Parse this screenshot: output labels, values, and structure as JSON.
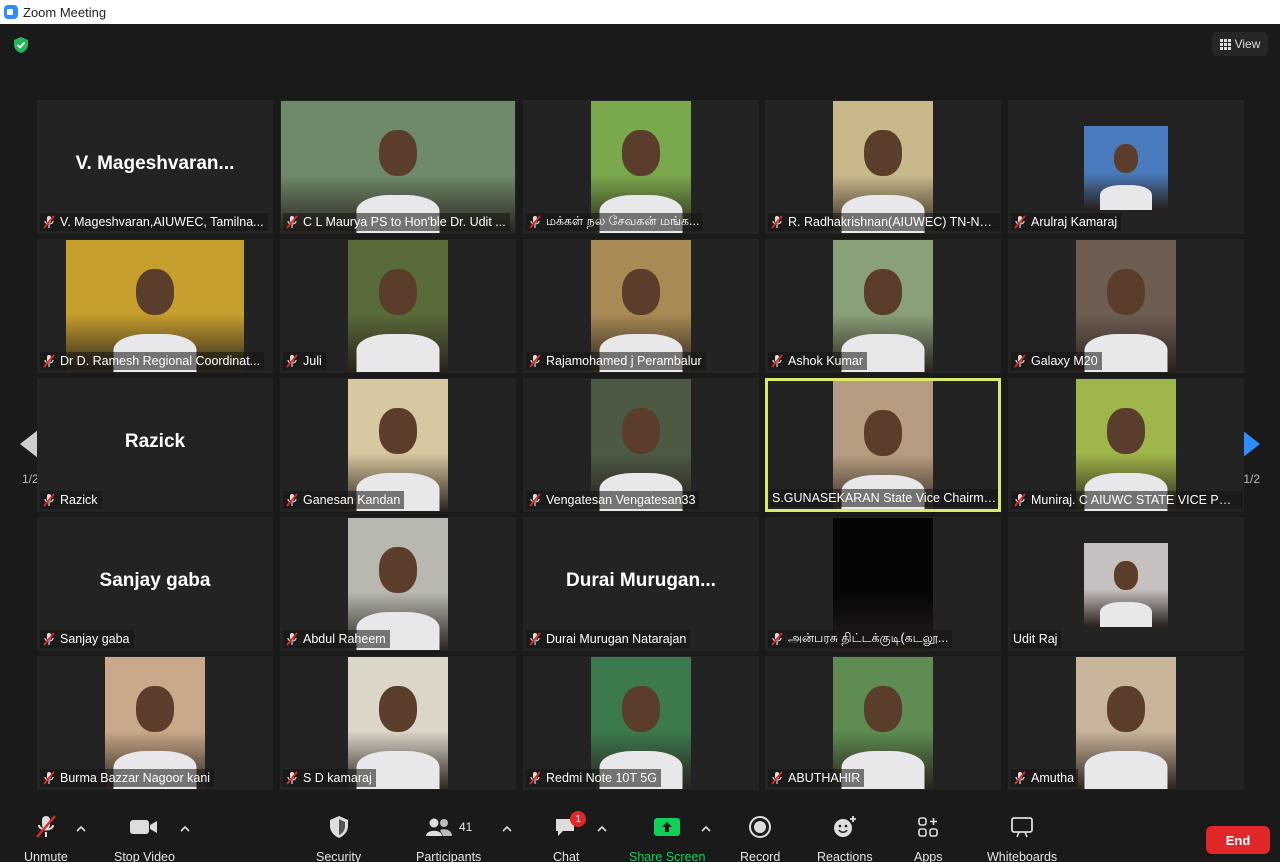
{
  "window": {
    "title": "Zoom Meeting"
  },
  "topbar": {
    "view_label": "View"
  },
  "pagination": {
    "left_page": "1/2",
    "right_page": "1/2"
  },
  "tiles": [
    {
      "name": "V. Mageshvaran,AIUWEC, Tamilna...",
      "big": "V.  Mageshvaran...",
      "video": false,
      "muted": true
    },
    {
      "name": "C L Maurya PS to Hon'ble Dr. Udit ...",
      "video": true,
      "vw": 236,
      "bg": "#6f8a6a",
      "muted": true
    },
    {
      "name": "மக்கள் நல சேவகன் மங்க...",
      "video": true,
      "vw": 100,
      "bg": "#7aa84c",
      "muted": true
    },
    {
      "name": "R. Radhakrishnan(AIUWEC) TN-Na...",
      "video": true,
      "vw": 100,
      "bg": "#c9b88a",
      "muted": true
    },
    {
      "name": "Arulraj Kamaraj",
      "video": true,
      "vw": 84,
      "bg": "#4a7bbf",
      "still": true,
      "muted": true
    },
    {
      "name": "Dr D. Ramesh Regional Coordinat...",
      "video": true,
      "vw": 178,
      "bg": "#c79f2e",
      "muted": true
    },
    {
      "name": "Juli",
      "video": true,
      "vw": 100,
      "bg": "#5a6b3a",
      "muted": true
    },
    {
      "name": "Rajamohamed j Perambalur",
      "video": true,
      "vw": 100,
      "bg": "#a88a55",
      "muted": true
    },
    {
      "name": "Ashok Kumar",
      "video": true,
      "vw": 100,
      "bg": "#8aa07a",
      "muted": true
    },
    {
      "name": "Galaxy M20",
      "video": true,
      "vw": 100,
      "bg": "#6e5e52",
      "muted": true
    },
    {
      "name": "Razick",
      "big": "Razick",
      "video": false,
      "muted": true
    },
    {
      "name": "Ganesan Kandan",
      "video": true,
      "vw": 100,
      "bg": "#d8c8a0",
      "muted": true
    },
    {
      "name": "Vengatesan Vengatesan33",
      "video": true,
      "vw": 100,
      "bg": "#4c5a44",
      "muted": true
    },
    {
      "name": "S.GUNASEKARAN State Vice Chairma...",
      "video": true,
      "vw": 100,
      "bg": "#b69c80",
      "muted": false,
      "active": true
    },
    {
      "name": "Muniraj. C AIUWC STATE VICE PRESID...",
      "video": true,
      "vw": 100,
      "bg": "#9fb64a",
      "muted": true
    },
    {
      "name": "Sanjay gaba",
      "big": "Sanjay gaba",
      "video": false,
      "muted": true
    },
    {
      "name": "Abdul Raheem",
      "video": true,
      "vw": 100,
      "bg": "#b8b8b0",
      "muted": true
    },
    {
      "name": "Durai Murugan Natarajan",
      "big": "Durai Murugan...",
      "video": false,
      "muted": true
    },
    {
      "name": "அன்பரசு திட்டக்குடி(கடலூ...",
      "video": true,
      "vw": 100,
      "bg": "#050505",
      "muted": true
    },
    {
      "name": "Udit Raj",
      "video": true,
      "vw": 84,
      "bg": "#c7c0c0",
      "still": true,
      "muted": false
    },
    {
      "name": "Burma Bazzar Nagoor kani",
      "video": true,
      "vw": 100,
      "bg": "#c9a98a",
      "muted": true
    },
    {
      "name": "S D kamaraj",
      "video": true,
      "vw": 100,
      "bg": "#dcd6c8",
      "muted": true
    },
    {
      "name": "Redmi Note 10T 5G",
      "video": true,
      "vw": 100,
      "bg": "#3c7a4e",
      "muted": true
    },
    {
      "name": "ABUTHAHIR",
      "video": true,
      "vw": 100,
      "bg": "#5e8c52",
      "muted": true
    },
    {
      "name": "Amutha",
      "video": true,
      "vw": 100,
      "bg": "#c9b49c",
      "muted": true
    }
  ],
  "toolbar": {
    "unmute": "Unmute",
    "stop_video": "Stop Video",
    "security": "Security",
    "participants": "Participants",
    "participants_count": "41",
    "chat": "Chat",
    "chat_badge": "1",
    "share_screen": "Share Screen",
    "record": "Record",
    "reactions": "Reactions",
    "apps": "Apps",
    "whiteboards": "Whiteboards",
    "end": "End"
  },
  "colors": {
    "accent": "#2d8cff",
    "active_speaker": "#d9e96a",
    "end": "#e02828",
    "share": "#0fd15a",
    "mute": "#e02828"
  }
}
